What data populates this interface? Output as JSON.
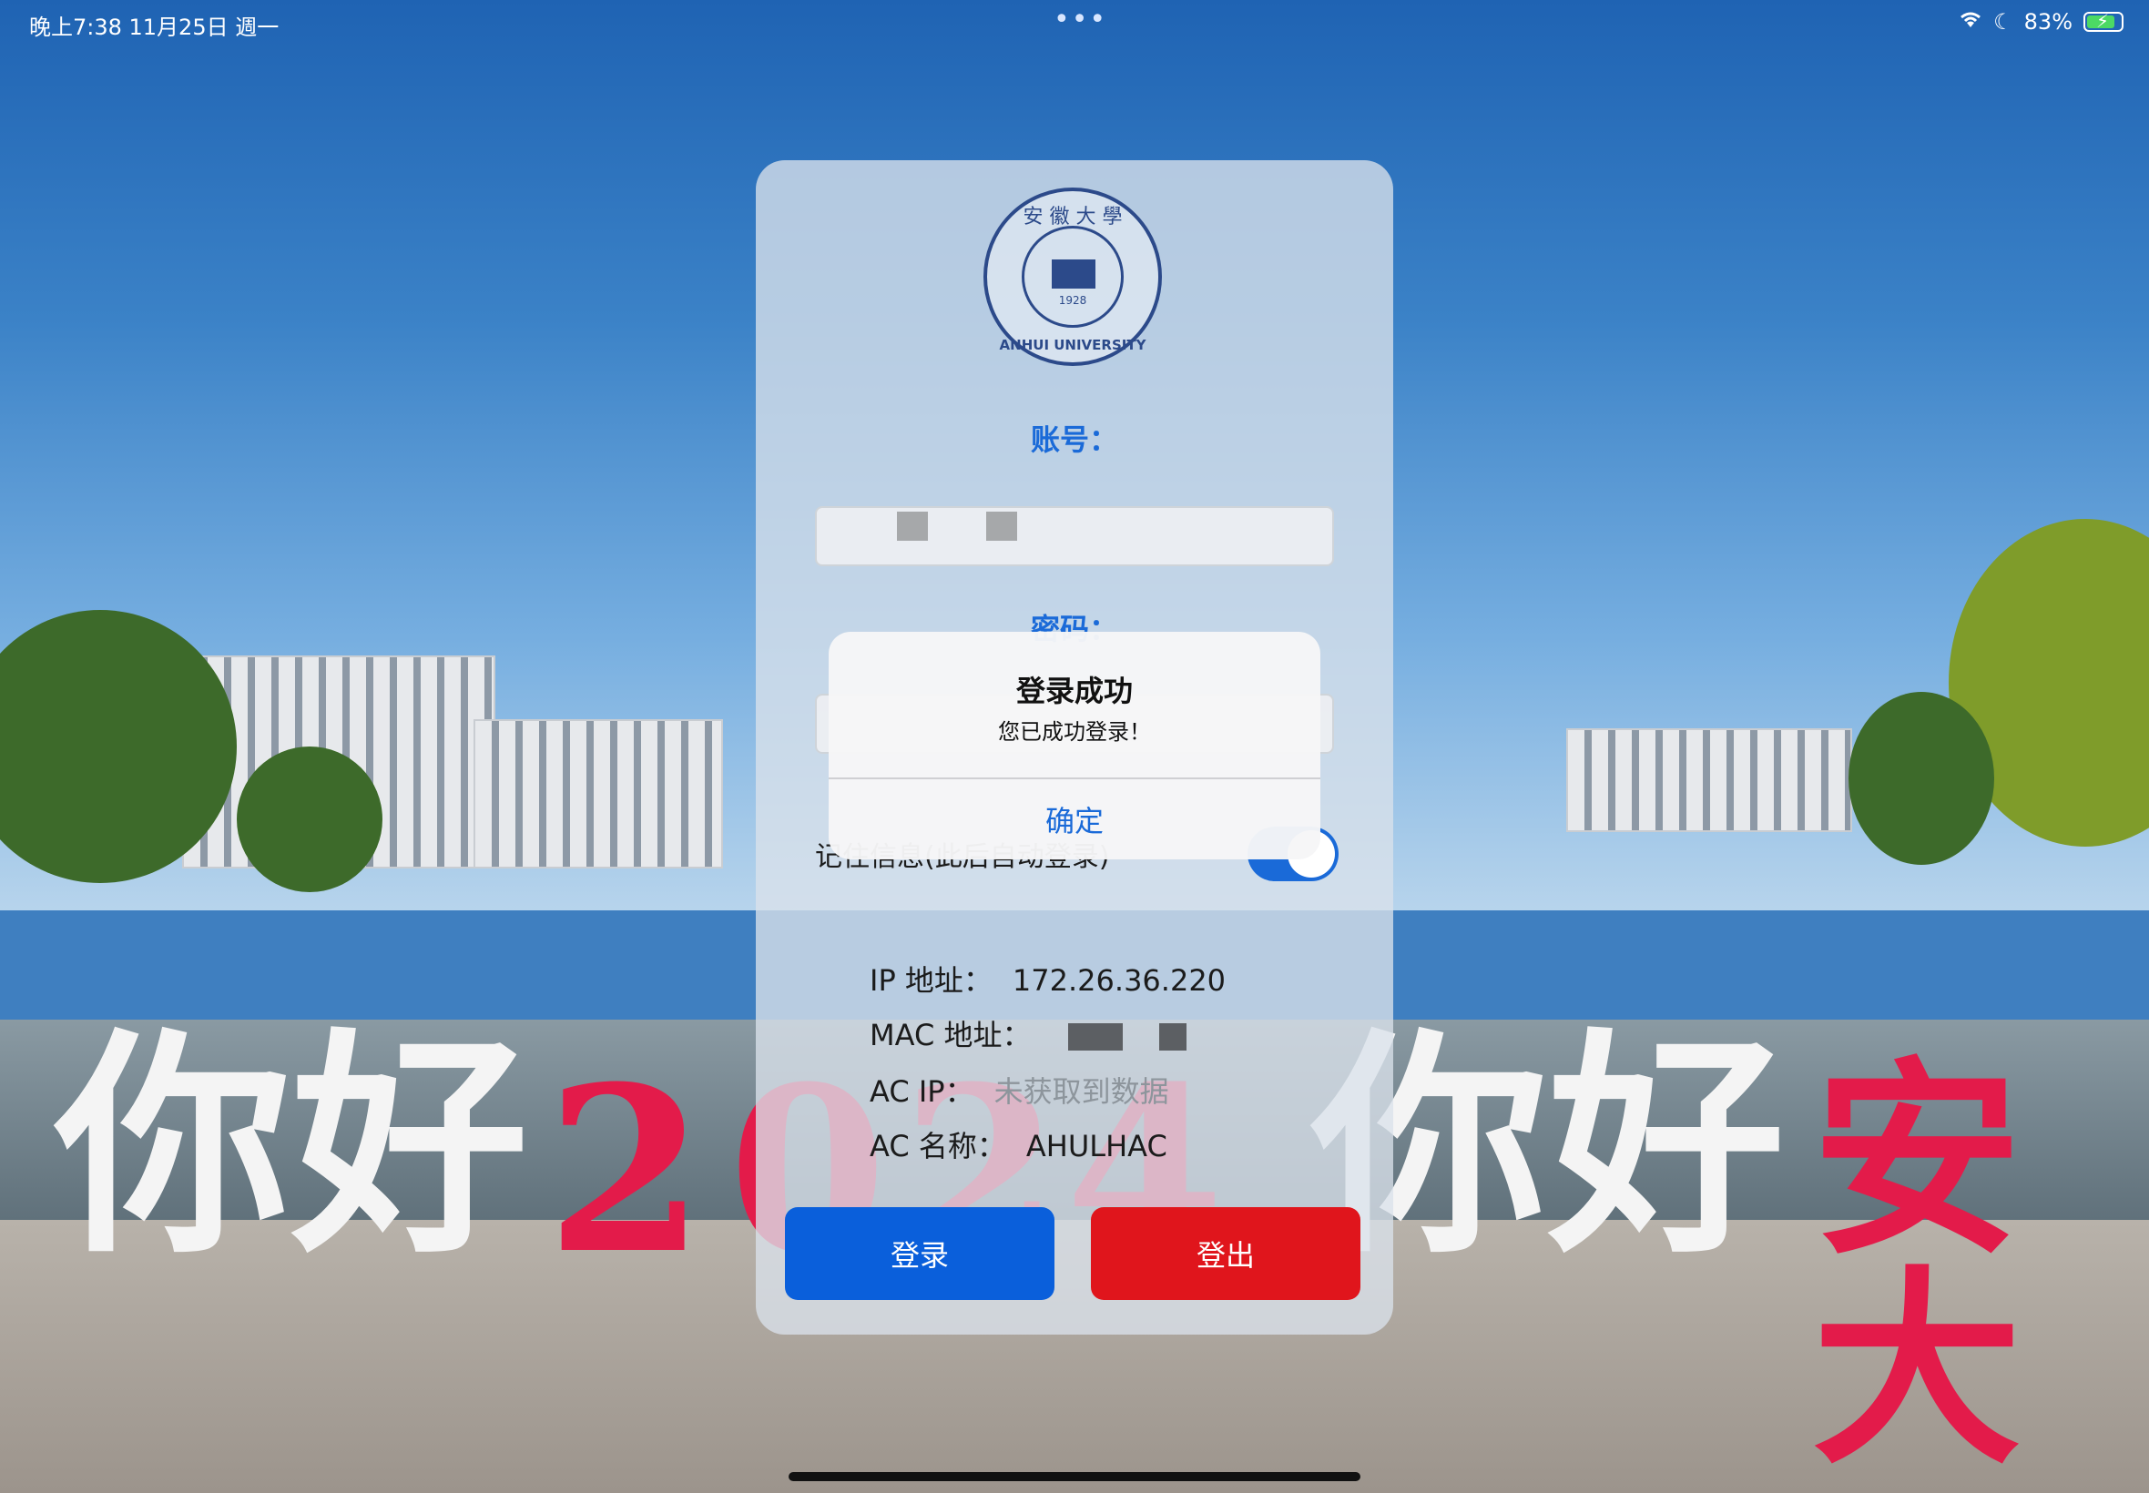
{
  "status_bar": {
    "time_date": "晚上7:38   11月25日 週一",
    "dots": "•••",
    "battery_percent": "83%",
    "battery_level": 0.83
  },
  "background": {
    "sign_text_left": "你好",
    "sign_text_year_a": "2",
    "sign_text_year_b": "0",
    "sign_text_year_c": "2",
    "sign_text_year_d": "4",
    "sign_text_right": "你好",
    "sign_text_red": "安大",
    "colors": {
      "white_letters": "#f4f4f4",
      "red_letters": "#e31b4a"
    }
  },
  "logo": {
    "top_text": "安 徽 大 學",
    "year": "1928",
    "ring_text": "ANHUI UNIVERSITY"
  },
  "form": {
    "account_label": "账号：",
    "password_label": "密码：",
    "remember_label": "记住信息(此后自动登录)",
    "remember_on": true
  },
  "info": {
    "ip_label": "IP 地址：",
    "ip_value": "172.26.36.220",
    "mac_label": "MAC 地址：",
    "ac_ip_label": "AC IP：",
    "ac_ip_value": "未获取到数据",
    "ac_name_label": "AC 名称：",
    "ac_name_value": "AHULHAC"
  },
  "buttons": {
    "login": "登录",
    "logout": "登出",
    "login_color": "#0a5fdb",
    "logout_color": "#e0151c"
  },
  "alert": {
    "title": "登录成功",
    "message": "您已成功登录！",
    "ok": "确定"
  }
}
